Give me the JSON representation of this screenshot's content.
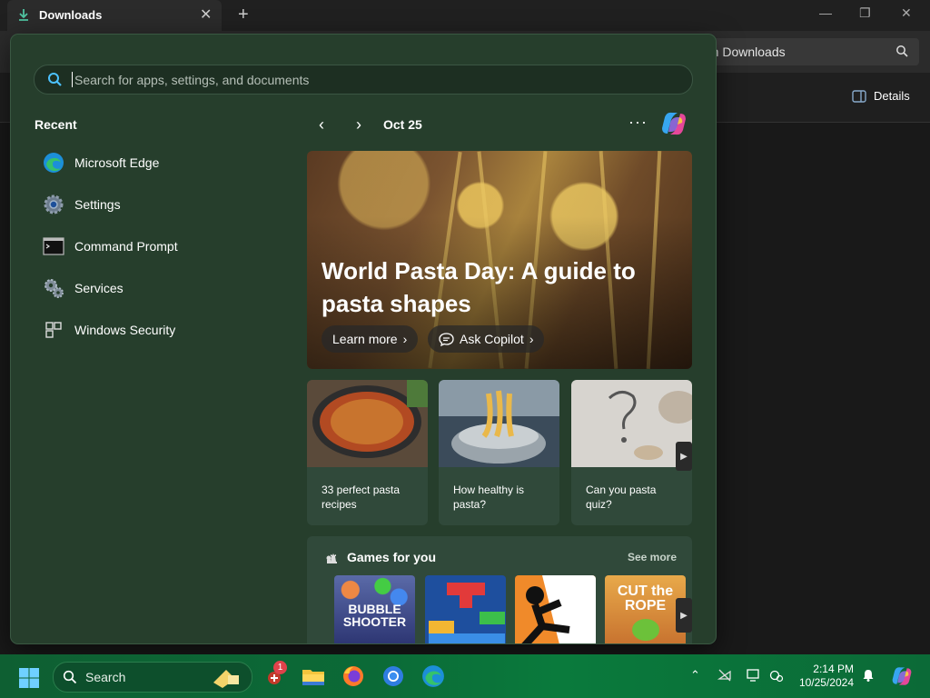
{
  "explorer": {
    "tab_title": "Downloads",
    "tab_close": "✕",
    "tab_add": "+",
    "search_text": "rch Downloads",
    "details_label": "Details",
    "minimize": "—",
    "maximize": "❐",
    "close": "✕"
  },
  "start": {
    "search_placeholder": "Search for apps, settings, and documents",
    "recent_heading": "Recent",
    "recent": [
      {
        "label": "Microsoft Edge",
        "icon": "edge-icon"
      },
      {
        "label": "Settings",
        "icon": "gear-icon"
      },
      {
        "label": "Command Prompt",
        "icon": "terminal-icon"
      },
      {
        "label": "Services",
        "icon": "services-icon"
      },
      {
        "label": "Windows Security",
        "icon": "shield-icon"
      }
    ],
    "nav_prev": "‹",
    "nav_next": "›",
    "date": "Oct 25",
    "more": "···",
    "hero": {
      "title": "World Pasta Day: A guide to pasta shapes",
      "learn_more": "Learn more",
      "ask_copilot": "Ask Copilot",
      "chevron": "›"
    },
    "cards": [
      {
        "text": "33 perfect pasta recipes"
      },
      {
        "text": "How healthy is pasta?"
      },
      {
        "text": "Can you pasta quiz?"
      }
    ],
    "card_next": "▶",
    "games": {
      "title": "Games for you",
      "see_more": "See more",
      "tiles": [
        {
          "label": "BUBBLE SHOOTER"
        },
        {
          "label": ""
        },
        {
          "label": ""
        },
        {
          "label": "CUT the ROPE"
        }
      ],
      "next": "▶"
    }
  },
  "taskbar": {
    "search_label": "Search",
    "badge_count": "1",
    "time": "2:14 PM",
    "date": "10/25/2024",
    "chevron": "⌃"
  },
  "colors": {
    "start_bg": "#263e2c",
    "taskbar": "#0b6a37",
    "accent": "#4cc2ff"
  }
}
